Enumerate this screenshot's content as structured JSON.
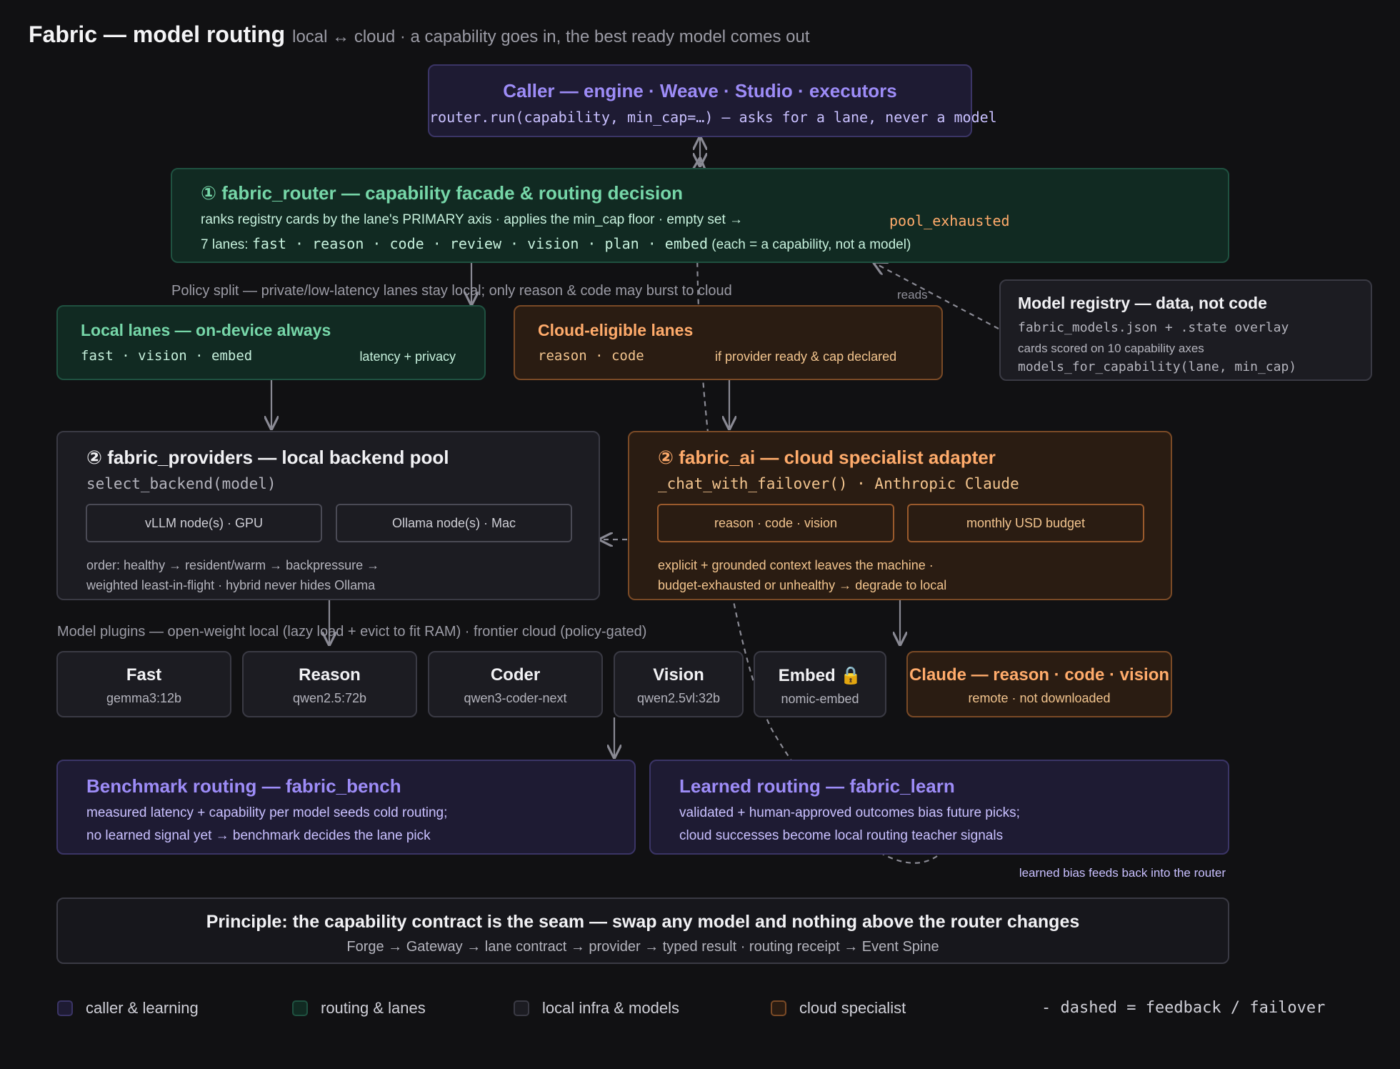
{
  "header": {
    "title": "Fabric — model routing",
    "subtitle": "local ↔ cloud · a capability goes in, the best ready model comes out"
  },
  "caller": {
    "title": "Caller — engine · Weave · Studio · executors",
    "code": "router.run(capability, min_cap=…) — asks for a lane, never a model"
  },
  "router": {
    "title": "① fabric_router — capability facade & routing decision",
    "line1": "ranks registry cards by the lane's PRIMARY axis · applies the min_cap floor · empty set →",
    "exhausted": "pool_exhausted",
    "lanes_prefix": "7 lanes:",
    "lanes": "fast · reason · code · review · vision · plan · embed",
    "lanes_suffix": "(each = a capability, not a model)"
  },
  "policy_note": "Policy split — private/low-latency lanes stay local; only reason & code may burst to cloud",
  "reads_label": "reads",
  "registry": {
    "title": "Model registry — data, not code",
    "file": "fabric_models.json + .state overlay",
    "desc": "cards scored on 10 capability axes",
    "fn": "models_for_capability(lane, min_cap)"
  },
  "local_lanes": {
    "title": "Local lanes — on-device always",
    "lanes": "fast · vision · embed",
    "tag": "latency + privacy"
  },
  "cloud_lanes": {
    "title": "Cloud-eligible lanes",
    "lanes": "reason · code",
    "tag": "if provider ready & cap declared"
  },
  "providers": {
    "title": "② fabric_providers — local backend pool",
    "fn": "select_backend(model)",
    "pill1": "vLLM node(s) · GPU",
    "pill2": "Ollama node(s) · Mac",
    "line1": "order: healthy → resident/warm → backpressure →",
    "line2": "weighted least-in-flight · hybrid never hides Ollama"
  },
  "fabric_ai": {
    "title": "② fabric_ai — cloud specialist adapter",
    "fn": "_chat_with_failover() · Anthropic Claude",
    "pill1": "reason · code · vision",
    "pill2": "monthly USD budget",
    "line1": "explicit + grounded context leaves the machine ·",
    "line2": "budget-exhausted or unhealthy → degrade to local"
  },
  "plugins_note": "Model plugins — open-weight local (lazy load + evict to fit RAM) · frontier cloud (policy-gated)",
  "models": [
    {
      "name": "Fast",
      "model": "gemma3:12b"
    },
    {
      "name": "Reason",
      "model": "qwen2.5:72b"
    },
    {
      "name": "Coder",
      "model": "qwen3-coder-next"
    },
    {
      "name": "Vision",
      "model": "qwen2.5vl:32b"
    },
    {
      "name": "Embed 🔒",
      "model": "nomic-embed"
    }
  ],
  "claude_card": {
    "name": "Claude — reason · code · vision",
    "model": "remote · not downloaded"
  },
  "bench": {
    "title": "Benchmark routing — fabric_bench",
    "line1": "measured latency + capability per model seeds cold routing;",
    "line2": "no learned signal yet → benchmark decides the lane pick"
  },
  "learn": {
    "title": "Learned routing — fabric_learn",
    "line1": "validated + human-approved outcomes bias future picks;",
    "line2": "cloud successes become local routing teacher signals"
  },
  "feedback_note": "learned bias feeds back into the router",
  "principle": {
    "title": "Principle: the capability contract is the seam — swap any model and nothing above the router changes",
    "sub": "Forge → Gateway → lane contract → provider → typed result · routing receipt → Event Spine"
  },
  "legend": {
    "caller": "caller & learning",
    "routing": "routing & lanes",
    "local": "local infra & models",
    "cloud": "cloud specialist",
    "dashed": "- dashed = feedback / failover"
  },
  "colors": {
    "purple": "#9d8cf7",
    "green": "#76d6a8",
    "orange": "#ffab6b",
    "background": "#111113"
  }
}
